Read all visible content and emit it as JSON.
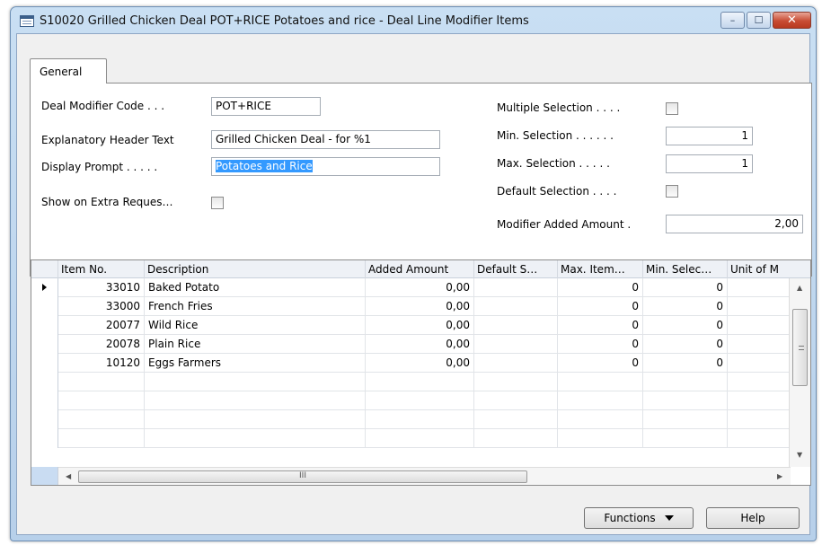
{
  "window": {
    "title": "S10020 Grilled Chicken Deal POT+RICE Potatoes and rice - Deal Line Modifier Items",
    "minimize": "–",
    "maximize": "☐",
    "close": "✕"
  },
  "tab": {
    "label": "General"
  },
  "form": {
    "deal_modifier_code_label": "Deal Modifier Code . . .",
    "deal_modifier_code_value": "POT+RICE",
    "explanatory_header_label": "Explanatory Header Text",
    "explanatory_header_value": "Grilled Chicken Deal - for %1",
    "display_prompt_label": "Display Prompt . . . . .",
    "display_prompt_value": "Potatoes and Rice",
    "show_extra_label": "Show on Extra Reques…",
    "multiple_selection_label": "Multiple Selection . . . .",
    "min_selection_label": "Min. Selection . . . . . .",
    "min_selection_value": "1",
    "max_selection_label": "Max. Selection . . . . .",
    "max_selection_value": "1",
    "default_selection_label": "Default Selection . . . .",
    "modifier_added_amount_label": "Modifier Added Amount .",
    "modifier_added_amount_value": "2,00"
  },
  "grid": {
    "columns": [
      "Item No.",
      "Description",
      "Added Amount",
      "Default S…",
      "Max. Item…",
      "Min. Selec…",
      "Unit of M"
    ],
    "rows": [
      [
        "33010",
        "Baked Potato",
        "0,00",
        "",
        "0",
        "0",
        ""
      ],
      [
        "33000",
        "French Fries",
        "0,00",
        "",
        "0",
        "0",
        ""
      ],
      [
        "20077",
        "Wild Rice",
        "0,00",
        "",
        "0",
        "0",
        ""
      ],
      [
        "20078",
        "Plain Rice",
        "0,00",
        "",
        "0",
        "0",
        ""
      ],
      [
        "10120",
        "Eggs Farmers",
        "0,00",
        "",
        "0",
        "0",
        ""
      ],
      [
        "",
        "",
        "",
        "",
        "",
        "",
        ""
      ],
      [
        "",
        "",
        "",
        "",
        "",
        "",
        ""
      ],
      [
        "",
        "",
        "",
        "",
        "",
        "",
        ""
      ],
      [
        "",
        "",
        "",
        "",
        "",
        "",
        ""
      ]
    ],
    "hscroll_grip": "III"
  },
  "buttons": {
    "functions": "Functions",
    "help": "Help"
  }
}
